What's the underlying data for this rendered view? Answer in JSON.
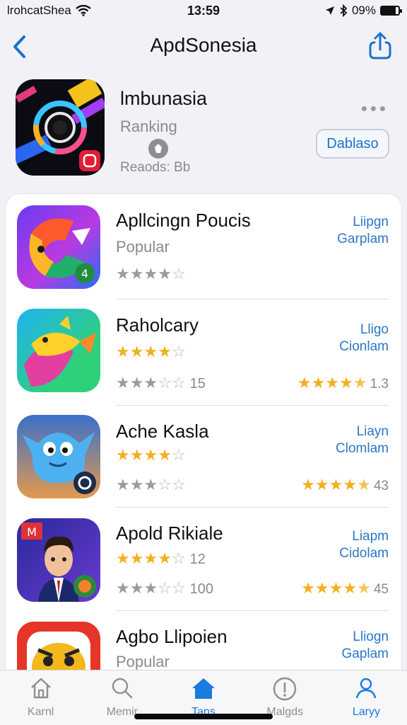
{
  "status_bar": {
    "carrier": "lrohcatShea",
    "time": "13:59",
    "battery": "09%",
    "battery_level": 0.85
  },
  "nav": {
    "title": "ApdSonesia",
    "back_icon": "chevron-left-icon",
    "share_icon": "share-icon"
  },
  "header_app": {
    "name": "lmbunasia",
    "subtitle": "Ranking",
    "meta": "Reaods: Bb",
    "more": "•••",
    "action_label": "Dablaso"
  },
  "apps": [
    {
      "title": "Apllcingn Poucis",
      "subtitle": "Popular",
      "rating": 4,
      "gray_rating": 4,
      "gray_count": "",
      "link_line1": "Liipgn",
      "link_line2": "Garplam",
      "right_rating": null,
      "right_value": ""
    },
    {
      "title": "Raholcary",
      "subtitle": "",
      "rating": 4,
      "gray_rating": 3,
      "gray_count": "15",
      "link_line1": "Lligo",
      "link_line2": "Cionlam",
      "right_rating": 4.5,
      "right_value": "1.3"
    },
    {
      "title": "Ache Kasla",
      "subtitle": "",
      "rating": 4,
      "gray_rating": 3,
      "gray_count": "",
      "link_line1": "Liayn",
      "link_line2": "Clomlam",
      "right_rating": 4.5,
      "right_value": "43"
    },
    {
      "title": "Apold Rikiale",
      "subtitle": "",
      "rating": 4,
      "gray_rating": 3,
      "gray_count": "100",
      "extra_count": "12",
      "link_line1": "Liapm",
      "link_line2": "Cidolam",
      "right_rating": 4.5,
      "right_value": "45"
    },
    {
      "title": "Agbo Llipoien",
      "subtitle": "Popular",
      "rating": null,
      "gray_rating": null,
      "gray_count": "",
      "link_line1": "Lliogn",
      "link_line2": "Gaplam",
      "right_rating": null,
      "right_value": ""
    }
  ],
  "tabs": [
    {
      "label": "Karnl",
      "icon": "home-outline-icon"
    },
    {
      "label": "Memir",
      "icon": "search-icon"
    },
    {
      "label": "Tans",
      "icon": "home-filled-icon",
      "active": true
    },
    {
      "label": "Malgds",
      "icon": "info-icon"
    },
    {
      "label": "Laryy",
      "icon": "profile-icon"
    }
  ],
  "colors": {
    "accent": "#1a7be0",
    "star": "#f2b01e",
    "link": "#2a77c6"
  }
}
